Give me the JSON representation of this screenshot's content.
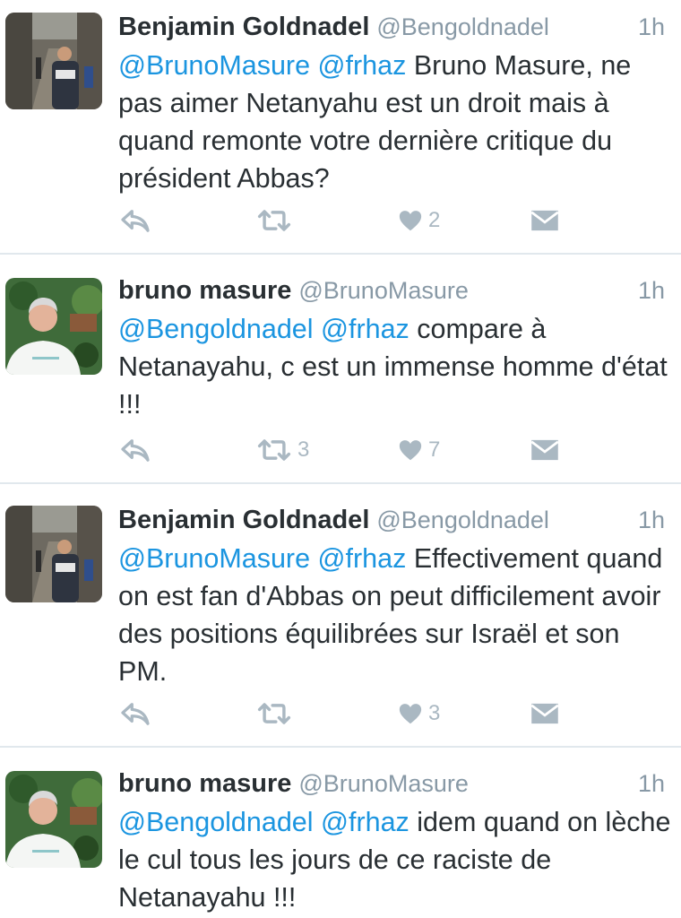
{
  "tweets": [
    {
      "name": "Benjamin Goldnadel",
      "handle": "@Bengoldnadel",
      "time": "1h",
      "mention1": "@BrunoMasure",
      "mention2": "@frhaz",
      "body": "Bruno Masure, ne pas aimer Netanyahu est un droit mais à quand remonte votre dernière critique du président Abbas?",
      "retweets": "",
      "likes": "2",
      "avatar": "street-photo-avatar"
    },
    {
      "name": "bruno masure",
      "handle": "@BrunoMasure",
      "time": "1h",
      "mention1": "@Bengoldnadel",
      "mention2": "@frhaz",
      "body": "compare à Netanayahu, c est un immense homme d'état !!!",
      "retweets": "3",
      "likes": "7",
      "avatar": "portrait-photo-avatar"
    },
    {
      "name": "Benjamin Goldnadel",
      "handle": "@Bengoldnadel",
      "time": "1h",
      "mention1": "@BrunoMasure",
      "mention2": "@frhaz",
      "body": "Effectivement quand on est fan d'Abbas on peut difficilement avoir des positions équilibrées sur Israël et son PM.",
      "retweets": "",
      "likes": "3",
      "avatar": "street-photo-avatar"
    },
    {
      "name": "bruno masure",
      "handle": "@BrunoMasure",
      "time": "1h",
      "mention1": "@Bengoldnadel",
      "mention2": "@frhaz",
      "body": "idem quand on lèche le cul tous les jours de ce raciste de Netanayahu !!!",
      "retweets": "",
      "likes": "",
      "avatar": "portrait-photo-avatar"
    }
  ],
  "icons": {
    "reply": "reply-icon",
    "retweet": "retweet-icon",
    "like": "heart-icon",
    "dm": "direct-message-icon"
  },
  "colors": {
    "mention": "#1b95e0",
    "secondary": "#8899a6",
    "icon": "#aab8c2",
    "divider": "#e1e8ed"
  }
}
